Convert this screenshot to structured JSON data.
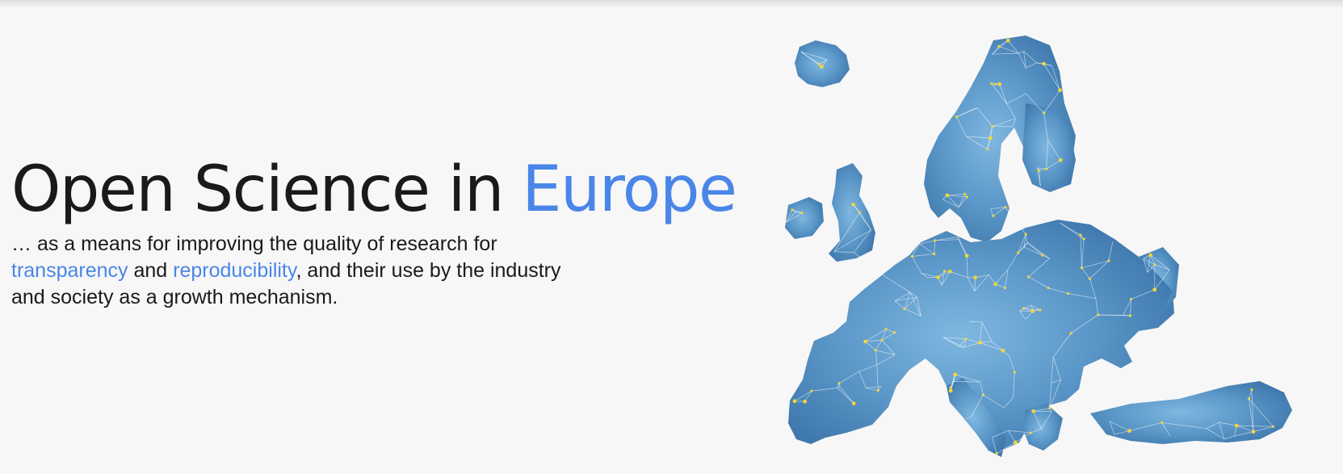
{
  "hero": {
    "title_main": "Open Science in ",
    "title_accent": "Europe",
    "subtitle_line1": "… as a means for improving the quality of research for",
    "subtitle_link1": "transparency",
    "subtitle_and": " and ",
    "subtitle_link2": "reproducibility",
    "subtitle_line2_rest": ", and their use by the industry",
    "subtitle_line3": "and society as a growth mechanism."
  },
  "colors": {
    "accent": "#4a86e8",
    "text": "#1a1a1a",
    "background": "#f7f7f7",
    "map_fill": "#4f8cc0",
    "map_nodes": "#f2d63a"
  },
  "map": {
    "icon": "europe-network-map-illustration"
  }
}
